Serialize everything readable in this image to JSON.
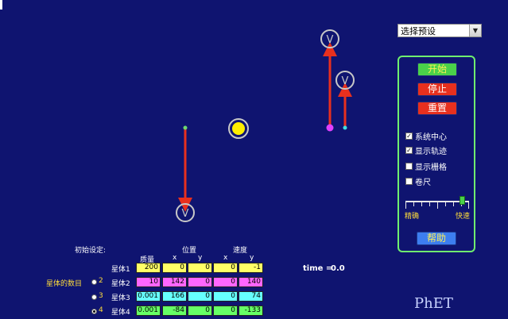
{
  "preset_select": {
    "selected": "选择预设"
  },
  "controls": {
    "start": "开始",
    "stop": "停止",
    "reset": "重置",
    "help": "帮助",
    "checkboxes": [
      {
        "label": "系统中心",
        "checked": true
      },
      {
        "label": "显示轨迹",
        "checked": true
      },
      {
        "label": "显示栅格",
        "checked": false
      },
      {
        "label": "卷尺",
        "checked": false
      }
    ],
    "speed_slider": {
      "left_label": "精确",
      "right_label": "快速",
      "value": 0.9
    }
  },
  "table": {
    "title": "初始设定:",
    "col_mass": "质量",
    "col_position": "位置",
    "col_velocity": "速度",
    "x": "x",
    "y": "y",
    "body_count_label": "星体的数目",
    "count_options": [
      "2",
      "3",
      "4"
    ],
    "count_selected": "4",
    "rows": [
      {
        "label": "星体1",
        "mass": "200",
        "px": "0",
        "py": "0",
        "vx": "0",
        "vy": "-1"
      },
      {
        "label": "星体2",
        "mass": "10",
        "px": "142",
        "py": "0",
        "vx": "0",
        "vy": "140"
      },
      {
        "label": "星体3",
        "mass": "0.001",
        "px": "166",
        "py": "0",
        "vx": "0",
        "vy": "74"
      },
      {
        "label": "星体4",
        "mass": "0.001",
        "px": "-84",
        "py": "0",
        "vx": "0",
        "vy": "-133"
      }
    ]
  },
  "time": {
    "label": "time =",
    "value": "0.0"
  },
  "logo": "PhET",
  "bodies": [
    {
      "name": "body1",
      "color": "#ffee00"
    },
    {
      "name": "body2",
      "color": "#e040ff"
    },
    {
      "name": "body3",
      "color": "#40e0e0"
    },
    {
      "name": "body4",
      "color": "#6fd86f"
    }
  ],
  "colors": {
    "background": "#0f1470",
    "panel_border": "#6ff06f",
    "arrow": "#e8301e",
    "start_button": "#4ad14a",
    "stop_button": "#e8301e",
    "reset_button": "#e8301e",
    "help_button": "#3d7ef0",
    "mass_cells": "#ffff99",
    "body1_cells": "#ffff66",
    "body2_cells": "#ff66ff",
    "body3_cells": "#66ffff",
    "body4_cells": "#66ff66",
    "label_yellow": "#ffdd3a"
  }
}
